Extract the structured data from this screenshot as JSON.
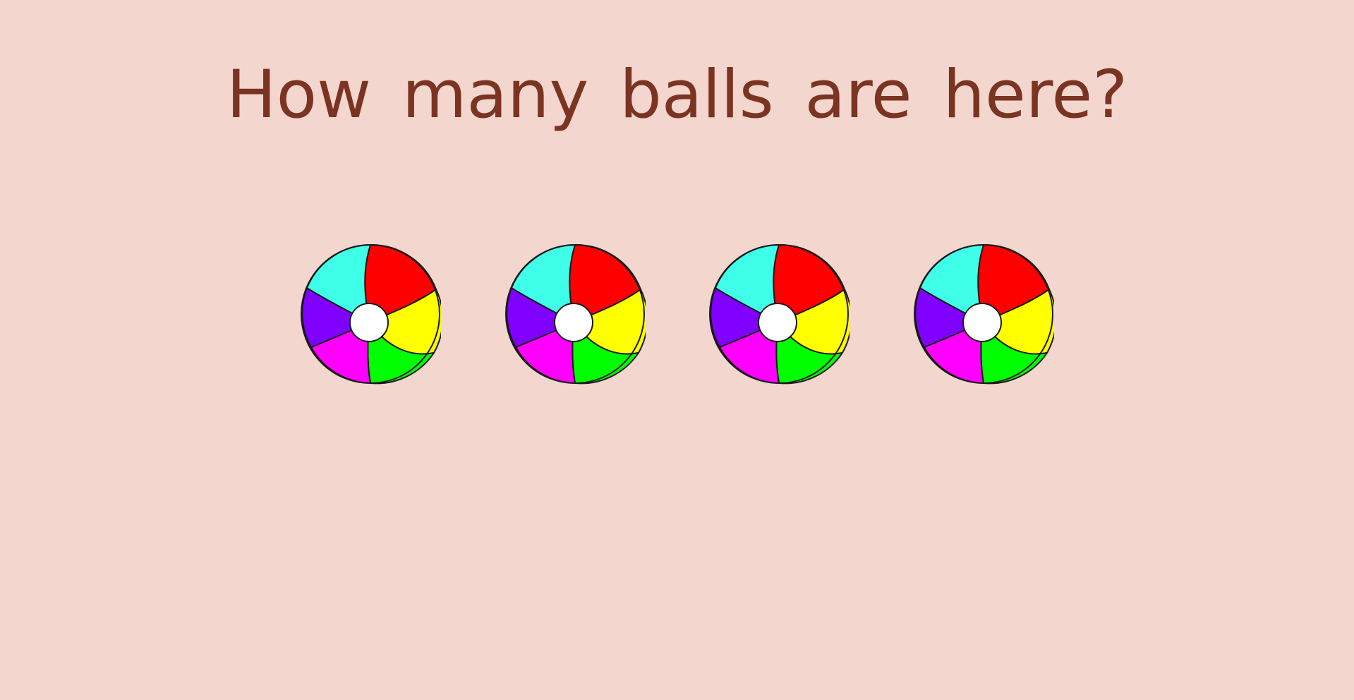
{
  "question": "How many balls are here?",
  "colors": {
    "background": "#f3d6ce",
    "question_text": "#7b3422"
  },
  "ball": {
    "icon": "beach-ball-icon",
    "count": 4,
    "panel_colors": {
      "red": "#ff0000",
      "yellow": "#ffff00",
      "green": "#00ff00",
      "magenta": "#ff00ff",
      "purple": "#8000ff",
      "cyan": "#40ffe8",
      "center": "#ffffff"
    }
  }
}
